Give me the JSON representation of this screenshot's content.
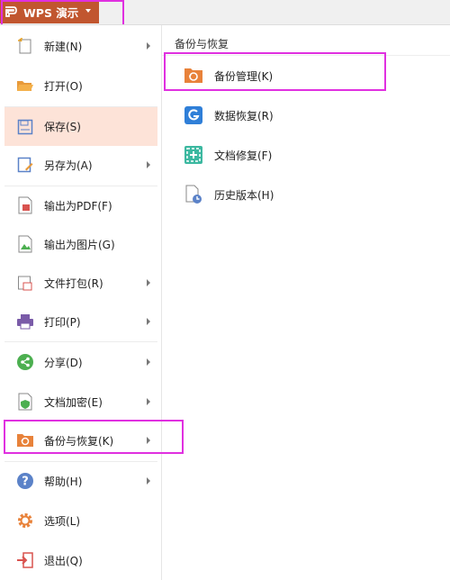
{
  "app": {
    "title": "WPS 演示"
  },
  "left_menu": [
    {
      "label": "新建(N)",
      "icon": "new-file-icon",
      "arrow": true
    },
    {
      "label": "打开(O)",
      "icon": "open-folder-icon",
      "arrow": false
    },
    {
      "label": "保存(S)",
      "icon": "save-icon",
      "arrow": false,
      "active": true
    },
    {
      "label": "另存为(A)",
      "icon": "save-as-icon",
      "arrow": true
    },
    {
      "label": "输出为PDF(F)",
      "icon": "export-pdf-icon",
      "arrow": false
    },
    {
      "label": "输出为图片(G)",
      "icon": "export-image-icon",
      "arrow": false
    },
    {
      "label": "文件打包(R)",
      "icon": "package-icon",
      "arrow": true
    },
    {
      "label": "打印(P)",
      "icon": "print-icon",
      "arrow": true
    },
    {
      "label": "分享(D)",
      "icon": "share-icon",
      "arrow": true
    },
    {
      "label": "文档加密(E)",
      "icon": "encrypt-icon",
      "arrow": true
    },
    {
      "label": "备份与恢复(K)",
      "icon": "backup-icon",
      "arrow": true
    },
    {
      "label": "帮助(H)",
      "icon": "help-icon",
      "arrow": true
    },
    {
      "label": "选项(L)",
      "icon": "options-gear-icon",
      "arrow": false
    },
    {
      "label": "退出(Q)",
      "icon": "exit-icon",
      "arrow": false
    }
  ],
  "submenu": {
    "title": "备份与恢复",
    "items": [
      {
        "label": "备份管理(K)",
        "icon": "backup-manage-icon"
      },
      {
        "label": "数据恢复(R)",
        "icon": "data-recovery-icon"
      },
      {
        "label": "文档修复(F)",
        "icon": "doc-repair-icon"
      },
      {
        "label": "历史版本(H)",
        "icon": "history-version-icon"
      }
    ]
  },
  "colors": {
    "accent": "#c1562f",
    "highlight": "#e030e0",
    "active_bg": "#fde3d8"
  }
}
